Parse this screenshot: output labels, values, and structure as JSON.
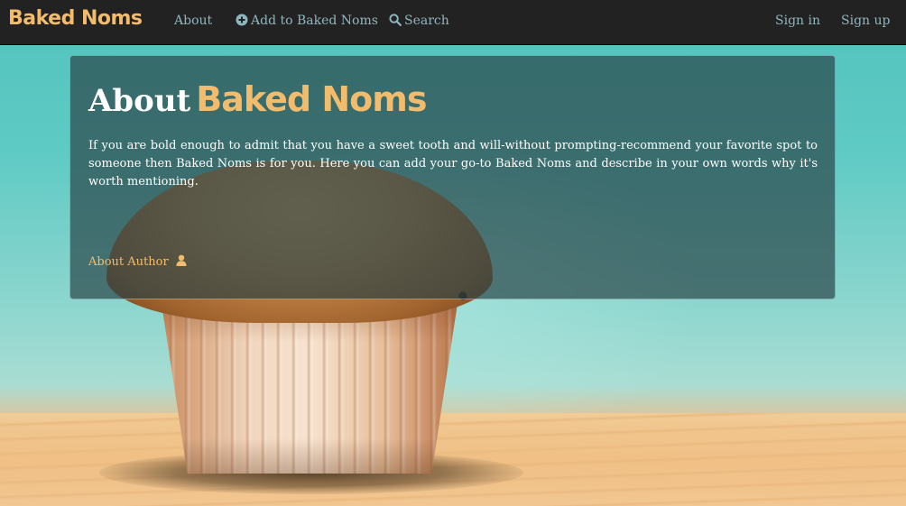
{
  "navbar": {
    "brand": "Baked Noms",
    "links": [
      {
        "label": "About",
        "icon": ""
      },
      {
        "label": "Add to Baked Noms",
        "icon": "plus-circle-icon"
      },
      {
        "label": "Search",
        "icon": "search-icon"
      }
    ],
    "right_links": [
      {
        "label": "Sign in"
      },
      {
        "label": "Sign up"
      }
    ]
  },
  "about": {
    "title_prefix": "About",
    "title_brand": "Baked Noms",
    "description": "If you are bold enough to admit that you have a sweet tooth and will-without prompting-recommend your favorite spot to someone then Baked Noms is for you. Here you can add your go-to Baked Noms and describe in your own words why it's worth mentioning.",
    "author_link": "About Author",
    "author_icon": "user-icon"
  },
  "colors": {
    "navbar_bg": "#222222",
    "brand": "#f2bc6c",
    "nav_link": "#8fb6be",
    "panel_bg": "rgba(40,65,70,0.68)"
  }
}
